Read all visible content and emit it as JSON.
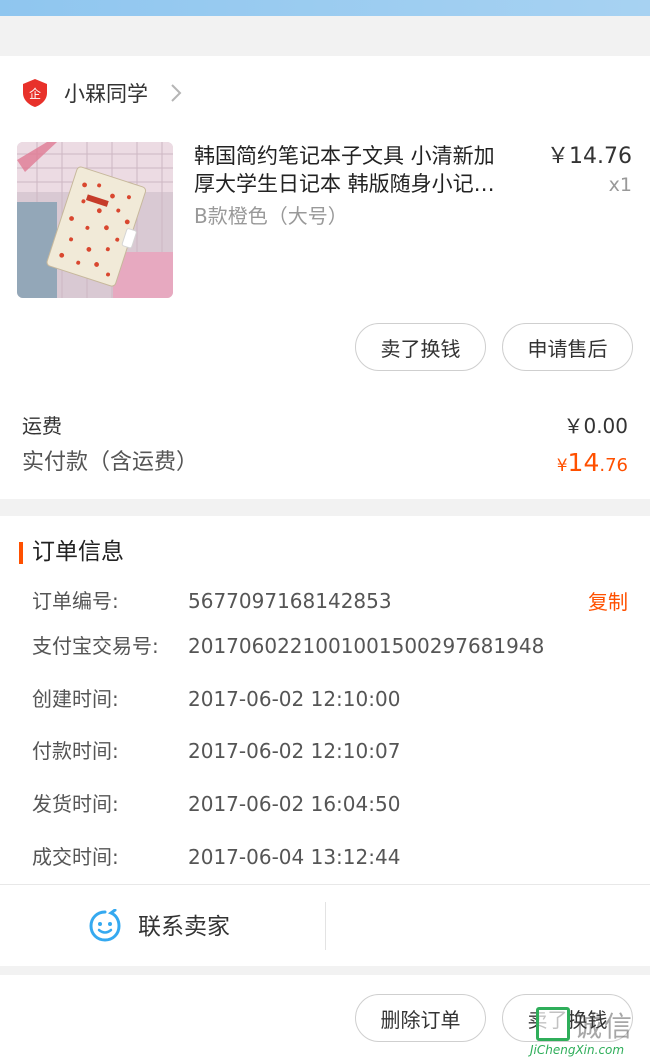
{
  "shop": {
    "name": "小槑同学",
    "badge": "企"
  },
  "product": {
    "title_line1": "韩国简约笔记本子文具 小清新加",
    "title_line2": "厚大学生日记本 韩版随身小记…",
    "variant": "B款橙色（大号）",
    "price": "￥14.76",
    "quantity": "x1"
  },
  "item_actions": {
    "sell": "卖了换钱",
    "after_sale": "申请售后"
  },
  "fees": {
    "shipping_label": "运费",
    "shipping_value": "￥0.00",
    "paid_label": "实付款（含运费）",
    "paid_symbol": "¥",
    "paid_int": "14",
    "paid_dec": ".76"
  },
  "order_info": {
    "title": "订单信息",
    "copy_label": "复制",
    "rows": [
      {
        "key": "订单编号:",
        "value": "5677097168142853"
      },
      {
        "key": "支付宝交易号:",
        "value": "2017060221001001500297681948"
      },
      {
        "key": "创建时间:",
        "value": "2017-06-02 12:10:00"
      },
      {
        "key": "付款时间:",
        "value": "2017-06-02 12:10:07"
      },
      {
        "key": "发货时间:",
        "value": "2017-06-02 16:04:50"
      },
      {
        "key": "成交时间:",
        "value": "2017-06-04 13:12:44"
      }
    ]
  },
  "contact": {
    "label": "联系卖家"
  },
  "bottom_actions": {
    "delete": "删除订单",
    "sell": "卖了换钱"
  },
  "watermark": {
    "chars": "诚信",
    "url": "JiChengXin.com"
  },
  "colors": {
    "accent": "#ff5000",
    "topbar": "#8fc6ef",
    "contact_icon": "#35a9f0",
    "watermark_green": "#2fae5a"
  }
}
